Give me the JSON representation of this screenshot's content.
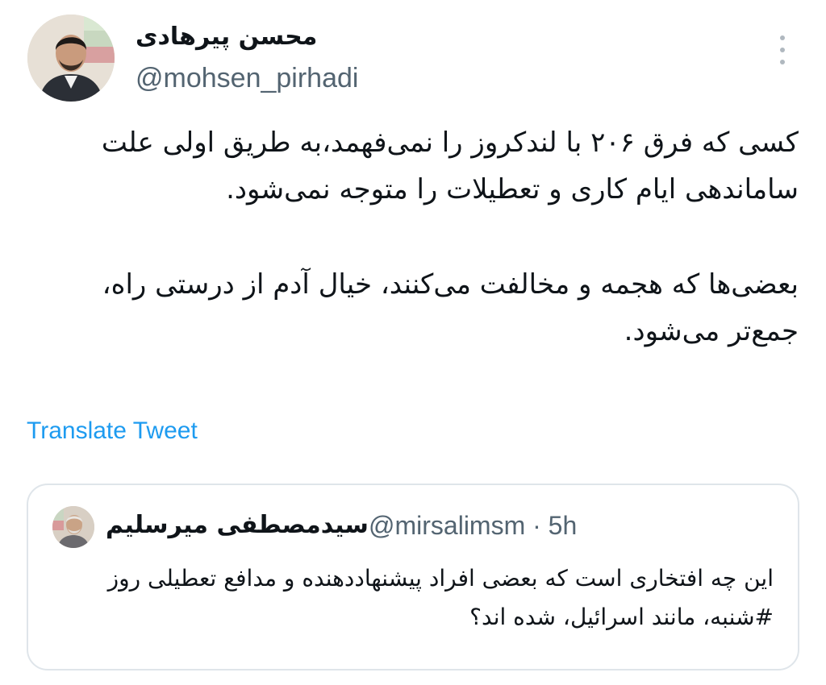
{
  "author": {
    "display_name": "محسن پیرهادی",
    "handle": "@mohsen_pirhadi"
  },
  "tweet": {
    "paragraphs": [
      "کسی که فرق ۲۰۶ با لندکروز را نمی‌فهمد،به طریق اولی علت ساماندهی ایام کاری و تعطیلات را متوجه نمی‌شود.",
      "بعضی‌ها که هجمه و مخالفت می‌کنند، خیال آدم از درستی راه، جمع‌تر می‌شود."
    ],
    "translate_label": "Translate Tweet"
  },
  "quote": {
    "display_name": "سیدمصطفی میرسلیم",
    "handle_time": "@mirsalimsm · 5h",
    "text": "این چه افتخاری است که بعضی افراد پیشنهاددهنده و مدافع تعطیلی روز #شنبه، مانند اسرائیل،  شده اند؟"
  },
  "icons": {
    "more": "more-vertical-icon"
  },
  "colors": {
    "link": "#1d9bf0",
    "secondary_text": "#536471",
    "border": "#dfe5ea"
  }
}
